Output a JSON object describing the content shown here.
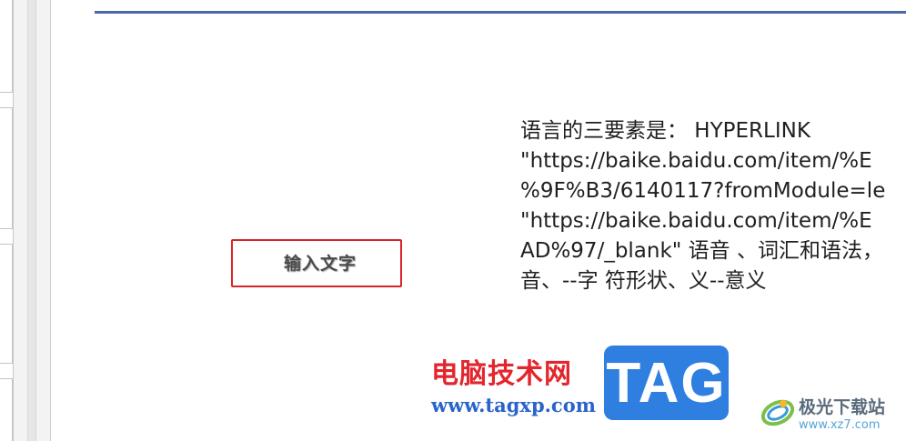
{
  "slide": {
    "text_box_label": "输入文字",
    "body_lines": [
      "语言的三要素是：  HYPERLINK",
      "\"https://baike.baidu.com/item/%E",
      "%9F%B3/6140117?fromModule=le",
      "\"https://baike.baidu.com/item/%E",
      "AD%97/_blank\" 语音 、词汇和语法，",
      "音、--字 符形状、义--意义"
    ]
  },
  "watermark": {
    "site_name": "电脑技术网",
    "site_url": "www.tagxp.com",
    "badge_text": "TAG",
    "xz_name": "极光下载站",
    "xz_url": "www.xz7.com"
  },
  "colors": {
    "title_rule": "#4a67a8",
    "text_box_border": "#d8232a",
    "watermark_red": "#e3262d",
    "watermark_blue": "#2a63c9",
    "tag_badge": "#2f7fe0"
  }
}
